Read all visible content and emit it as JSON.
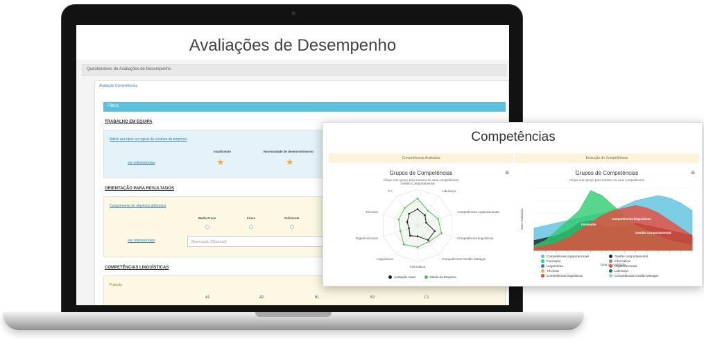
{
  "page": {
    "title": "Avaliações de Desempenho",
    "breadcrumb": "Questionários de Avaliações de Desempenho",
    "panel_tab": "Avaliação Competências",
    "filter_label": "Filtros"
  },
  "sections": [
    {
      "title": "TRABALHO EM EQUIPA",
      "question": "Adere aos tipos ou regras de conduta da empresa",
      "link": "ver critérios/notas",
      "columns": [
        "Insuficiente",
        "Necessidade de desenvolvimento"
      ]
    },
    {
      "title": "ORIENTAÇÃO PARA RESULTADOS",
      "question": "Cumprimento de objetivos atribuídos",
      "link": "ver critérios/notas",
      "columns": [
        "Muito Fraco",
        "Fraco",
        "Suficiente"
      ],
      "input_placeholder": "Observação (Opcional)"
    },
    {
      "title": "COMPETÊNCIAS LINGUÍSTICAS",
      "question": "Francês",
      "scale": [
        "A1",
        "A2",
        "B1",
        "B2",
        "C1"
      ]
    }
  ],
  "overlay": {
    "title": "Competências",
    "left_panel": {
      "header": "Competências Avaliadas",
      "chart_title": "Grupos de Competências",
      "chart_subtitle": "Clique num grupo para mostrar as suas competências"
    },
    "right_panel": {
      "header": "Evolução de Competências",
      "chart_title": "Grupos de Competências",
      "chart_subtitle": "Clique num grupo para mostrar as suas competências"
    }
  },
  "chart_data": [
    {
      "type": "radar",
      "title": "Grupos de Competências",
      "subtitle": "Clique num grupo para mostrar as suas competências",
      "axes": [
        "Gestão Comportamental",
        "Liderança",
        "Competências organizacionais",
        "Competências linguísticas",
        "Competências Gestão Manager",
        "Informática",
        "Linguísticas",
        "Organizacionais",
        "Técnicas",
        "T.A."
      ],
      "series": [
        {
          "name": "Avaliação Atual",
          "color": "#222222",
          "values": [
            0.45,
            0.35,
            0.25,
            0.5,
            0.5,
            0.3,
            0.35,
            0.25,
            0.3,
            0.4
          ]
        },
        {
          "name": "Média da Empresa",
          "color": "#5cb85c",
          "values": [
            0.75,
            0.5,
            0.6,
            0.7,
            0.55,
            0.6,
            0.65,
            0.5,
            0.55,
            0.6
          ]
        }
      ]
    },
    {
      "type": "area",
      "title": "Grupos de Competências",
      "subtitle": "Clique num grupo para mostrar as suas competências",
      "xlabel": "Data da Avaliação",
      "ylabel": "Valor Avaliação",
      "series": [
        {
          "name": "Competências organizacionais",
          "color": "#5bc0de",
          "values": [
            0.9,
            1.0,
            1.1,
            1.2,
            1.3,
            1.4,
            1.5,
            1.6,
            1.8,
            2.0,
            2.1,
            2.2,
            2.1,
            1.9,
            1.6
          ]
        },
        {
          "name": "Gestão comportamental",
          "color": "#222222",
          "values": [
            0.4,
            0.5,
            0.6,
            0.8,
            1.1,
            1.2,
            1.0,
            0.9,
            1.0,
            1.1,
            1.0,
            0.9,
            0.8,
            0.7,
            0.6
          ]
        },
        {
          "name": "Formação",
          "color": "#2ecc71",
          "values": [
            0.2,
            0.4,
            0.8,
            1.2,
            1.6,
            2.4,
            2.2,
            1.8,
            1.4,
            1.0,
            0.8,
            0.6,
            0.4,
            0.3,
            0.2
          ]
        },
        {
          "name": "Competências linguísticas",
          "color": "#e74c3c",
          "values": [
            0.1,
            0.2,
            0.3,
            0.5,
            0.8,
            1.1,
            1.4,
            1.6,
            1.7,
            1.8,
            1.7,
            1.5,
            1.2,
            0.9,
            0.6
          ]
        }
      ],
      "annotations": [
        "Formação",
        "Competências linguísticas",
        "Gestão comportamental"
      ],
      "legend": [
        {
          "name": "Competências organizacionais",
          "color": "#5bc0de"
        },
        {
          "name": "Gestão comportamental",
          "color": "#222222"
        },
        {
          "name": "Formação",
          "color": "#2ecc71"
        },
        {
          "name": "Informática",
          "color": "#888888"
        },
        {
          "name": "Linguísticas",
          "color": "#3b6fc9"
        },
        {
          "name": "Organizacionais",
          "color": "#d9534f"
        },
        {
          "name": "Técnicas",
          "color": "#f0ad4e"
        },
        {
          "name": "Liderança",
          "color": "#0b7a6b"
        },
        {
          "name": "Competências linguísticas",
          "color": "#e74c3c"
        },
        {
          "name": "Competências Gestão Manager",
          "color": "#7fd8e8"
        }
      ]
    }
  ]
}
